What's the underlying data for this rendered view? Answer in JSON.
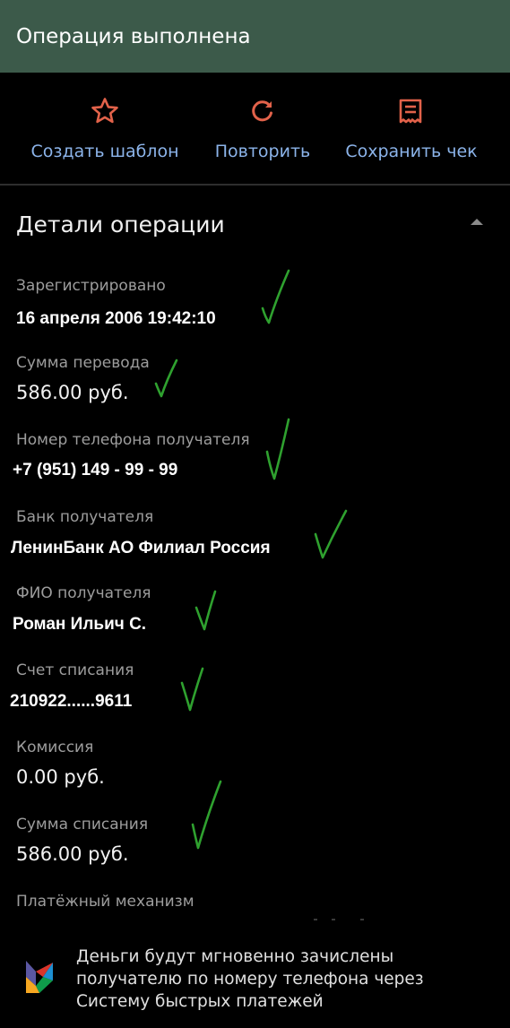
{
  "header": {
    "title": "Операция выполнена"
  },
  "actions": {
    "template_label": "Создать шаблон",
    "repeat_label": "Повторить",
    "receipt_label": "Сохранить чек"
  },
  "details": {
    "title": "Детали операции",
    "registered_label": "Зарегистрировано",
    "registered_value": "16 апреля 2006 19:42:10",
    "amount_label": "Сумма перевода",
    "amount_value": "586.00 руб.",
    "phone_label": "Номер телефона получателя",
    "phone_value": "+7 (951) 149 - 99 - 99",
    "bank_label": "Банк получателя",
    "bank_value": "ЛенинБанк АО Филиал Россия",
    "name_label": "ФИО получателя",
    "name_value": "Роман Ильич С.",
    "account_label": "Счет списания",
    "account_value": "210922......9611",
    "fee_label": "Комиссия",
    "fee_value": "0.00 руб.",
    "debit_label": "Сумма списания",
    "debit_value": "586.00 руб.",
    "mechanism_label": "Платёжный механизм"
  },
  "sbp_note": {
    "line1": "Деньги будут мгновенно зачислены",
    "line2": "получателю по номеру телефона через",
    "line3": "Систему быстрых платежей"
  },
  "colors": {
    "header_bg": "#3c5a4a",
    "accent_icon": "#e2624a",
    "link": "#8cb4ea",
    "check_mark": "#2fa12f"
  },
  "icons": [
    "star-icon",
    "refresh-icon",
    "receipt-icon",
    "chevron-up-icon",
    "sbp-logo-icon",
    "check-mark-icon"
  ]
}
